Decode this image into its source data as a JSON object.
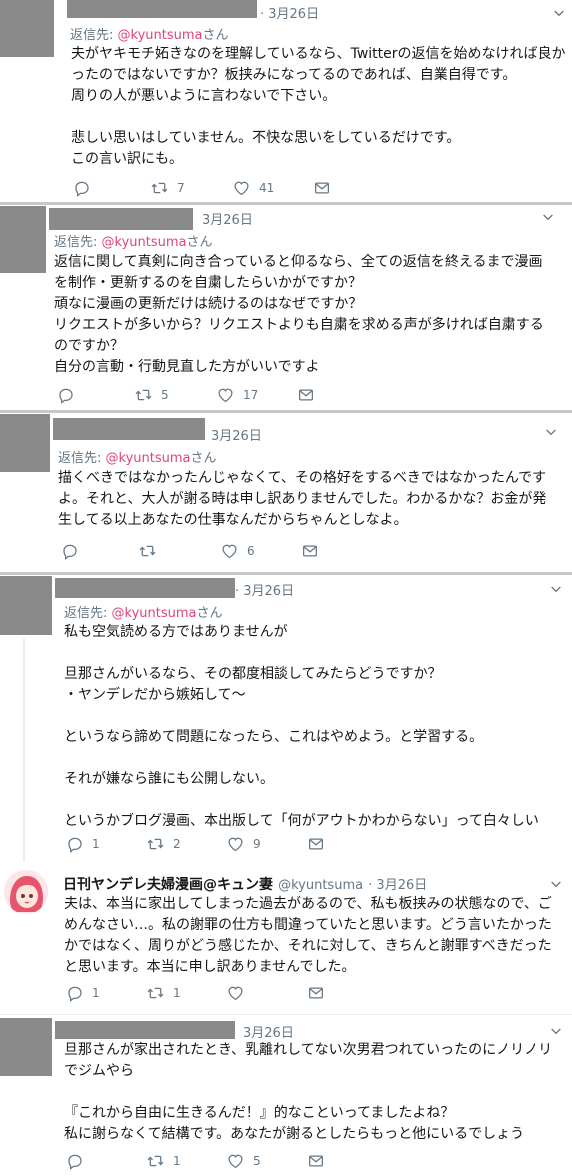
{
  "icons": [
    "reply-icon",
    "retweet-icon",
    "like-icon",
    "dm-icon",
    "chevron-down-icon"
  ],
  "colors": {
    "handle_pink": "#e0457b",
    "meta_gray": "#657786",
    "redaction": "#8a8a8a"
  },
  "tweets": [
    {
      "date": "· 3月26日",
      "reply_prefix": "返信先: ",
      "reply_handle": "@kyuntsuma",
      "reply_suffix": "さん",
      "lines": [
        "夫がヤキモチ妬きなのを理解しているなら、Twitterの返信を始めなければ良か",
        "ったのではないですか？板挟みになってるのであれば、自業自得です。",
        "周りの人が悪いように言わないで下さい。",
        "",
        "悲しい思いはしていません。不快な思いをしているだけです。",
        "この言い訳にも。"
      ],
      "replies": "",
      "retweets": "7",
      "likes": "41"
    },
    {
      "date": "3月26日",
      "reply_prefix": "返信先: ",
      "reply_handle": "@kyuntsuma",
      "reply_suffix": "さん",
      "lines": [
        "返信に関して真剣に向き合っていると仰るなら、全ての返信を終えるまで漫画",
        "を制作・更新するのを自粛したらいかがですか？",
        "頑なに漫画の更新だけは続けるのはなぜですか？",
        "リクエストが多いから？リクエストよりも自粛を求める声が多ければ自粛する",
        "のですか？",
        "自分の言動・行動見直した方がいいですよ"
      ],
      "replies": "",
      "retweets": "5",
      "likes": "17"
    },
    {
      "date": "3月26日",
      "reply_prefix": "返信先: ",
      "reply_handle": "@kyuntsuma",
      "reply_suffix": "さん",
      "lines": [
        "描くべきではなかったんじゃなくて、その格好をするべきではなかったんです",
        "よ。それと、大人が謝る時は申し訳ありませんでした。わかるかな？お金が発",
        "生してる以上あなたの仕事なんだからちゃんとしなよ。"
      ],
      "replies": "",
      "retweets": "",
      "likes": "6"
    },
    {
      "date": "· 3月26日",
      "reply_prefix": "返信先: ",
      "reply_handle": "@kyuntsuma",
      "reply_suffix": "さん",
      "lines": [
        "私も空気読める方ではありませんが",
        "",
        "旦那さんがいるなら、その都度相談してみたらどうですか？",
        "・ヤンデレだから嫉妬して〜",
        "",
        "というなら諦めて問題になったら、これはやめよう。と学習する。",
        "",
        "それが嫌なら誰にも公開しない。",
        "",
        "というかブログ漫画、本出版して「何がアウトかわからない」って白々しい"
      ],
      "replies": "1",
      "retweets": "2",
      "likes": "9"
    },
    {
      "display_name": "日刊ヤンデレ夫婦漫画@キュン妻",
      "handle": "@kyuntsuma",
      "date": "· 3月26日",
      "lines": [
        "夫は、本当に家出してしまった過去があるので、私も板挟みの状態なので、ご",
        "めんなさい…。私の謝罪の仕方も間違っていたと思います。どう言いたかった",
        "かではなく、周りがどう感じたか、それに対して、きちんと謝罪すべきだった",
        "と思います。本当に申し訳ありませんでした。"
      ],
      "replies": "1",
      "retweets": "1",
      "likes": ""
    },
    {
      "date": "3月26日",
      "lines": [
        "旦那さんが家出されたとき、乳離れしてない次男君つれていったのにノリノリ",
        "でジムやら",
        "",
        "『これから自由に生きるんだ！』的なこといってましたよね？",
        "私に謝らなくて結構です。あなたが謝るとしたらもっと他にいるでしょう"
      ],
      "replies": "",
      "retweets": "1",
      "likes": "5"
    }
  ]
}
